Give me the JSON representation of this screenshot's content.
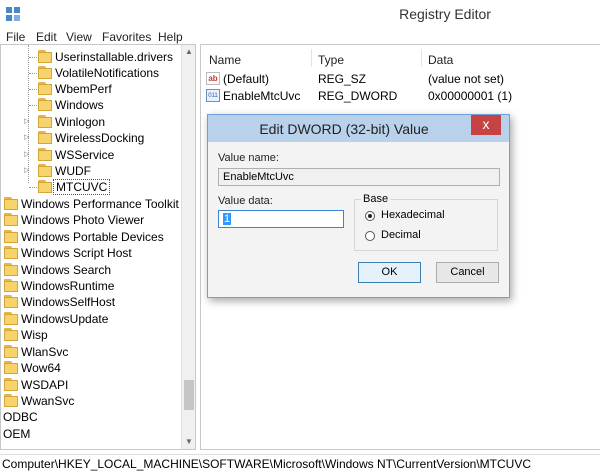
{
  "window": {
    "title": "Registry Editor"
  },
  "menu": [
    "File",
    "Edit",
    "View",
    "Favorites",
    "Help"
  ],
  "tree": {
    "subkeys": [
      {
        "label": "Userinstallable.drivers",
        "expandable": false
      },
      {
        "label": "VolatileNotifications",
        "expandable": false
      },
      {
        "label": "WbemPerf",
        "expandable": false
      },
      {
        "label": "Windows",
        "expandable": false
      },
      {
        "label": "Winlogon",
        "expandable": true
      },
      {
        "label": "WirelessDocking",
        "expandable": true
      },
      {
        "label": "WSService",
        "expandable": true
      },
      {
        "label": "WUDF",
        "expandable": true
      },
      {
        "label": "MTCUVC",
        "expandable": false,
        "selected": true
      }
    ],
    "keys": [
      "Windows Performance Toolkit",
      "Windows Photo Viewer",
      "Windows Portable Devices",
      "Windows Script Host",
      "Windows Search",
      "WindowsRuntime",
      "WindowsSelfHost",
      "WindowsUpdate",
      "Wisp",
      "WlanSvc",
      "Wow64",
      "WSDAPI",
      "WwanSvc"
    ],
    "root_keys": [
      "ODBC",
      "OEM"
    ]
  },
  "list": {
    "columns": [
      "Name",
      "Type",
      "Data"
    ],
    "rows": [
      {
        "icon": "string-value-icon",
        "name": "(Default)",
        "type": "REG_SZ",
        "data": "(value not set)"
      },
      {
        "icon": "binary-value-icon",
        "name": "EnableMtcUvc",
        "type": "REG_DWORD",
        "data": "0x00000001 (1)"
      }
    ]
  },
  "dialog": {
    "title": "Edit DWORD (32-bit) Value",
    "close_glyph": "x",
    "value_name_label": "Value name:",
    "value_name": "EnableMtcUvc",
    "value_data_label": "Value data:",
    "value_data": "1",
    "base_label": "Base",
    "base_options": [
      {
        "label": "Hexadecimal",
        "selected": true
      },
      {
        "label": "Decimal",
        "selected": false
      }
    ],
    "ok_label": "OK",
    "cancel_label": "Cancel"
  },
  "status": {
    "path": "Computer\\HKEY_LOCAL_MACHINE\\SOFTWARE\\Microsoft\\Windows NT\\CurrentVersion\\MTCUVC"
  }
}
